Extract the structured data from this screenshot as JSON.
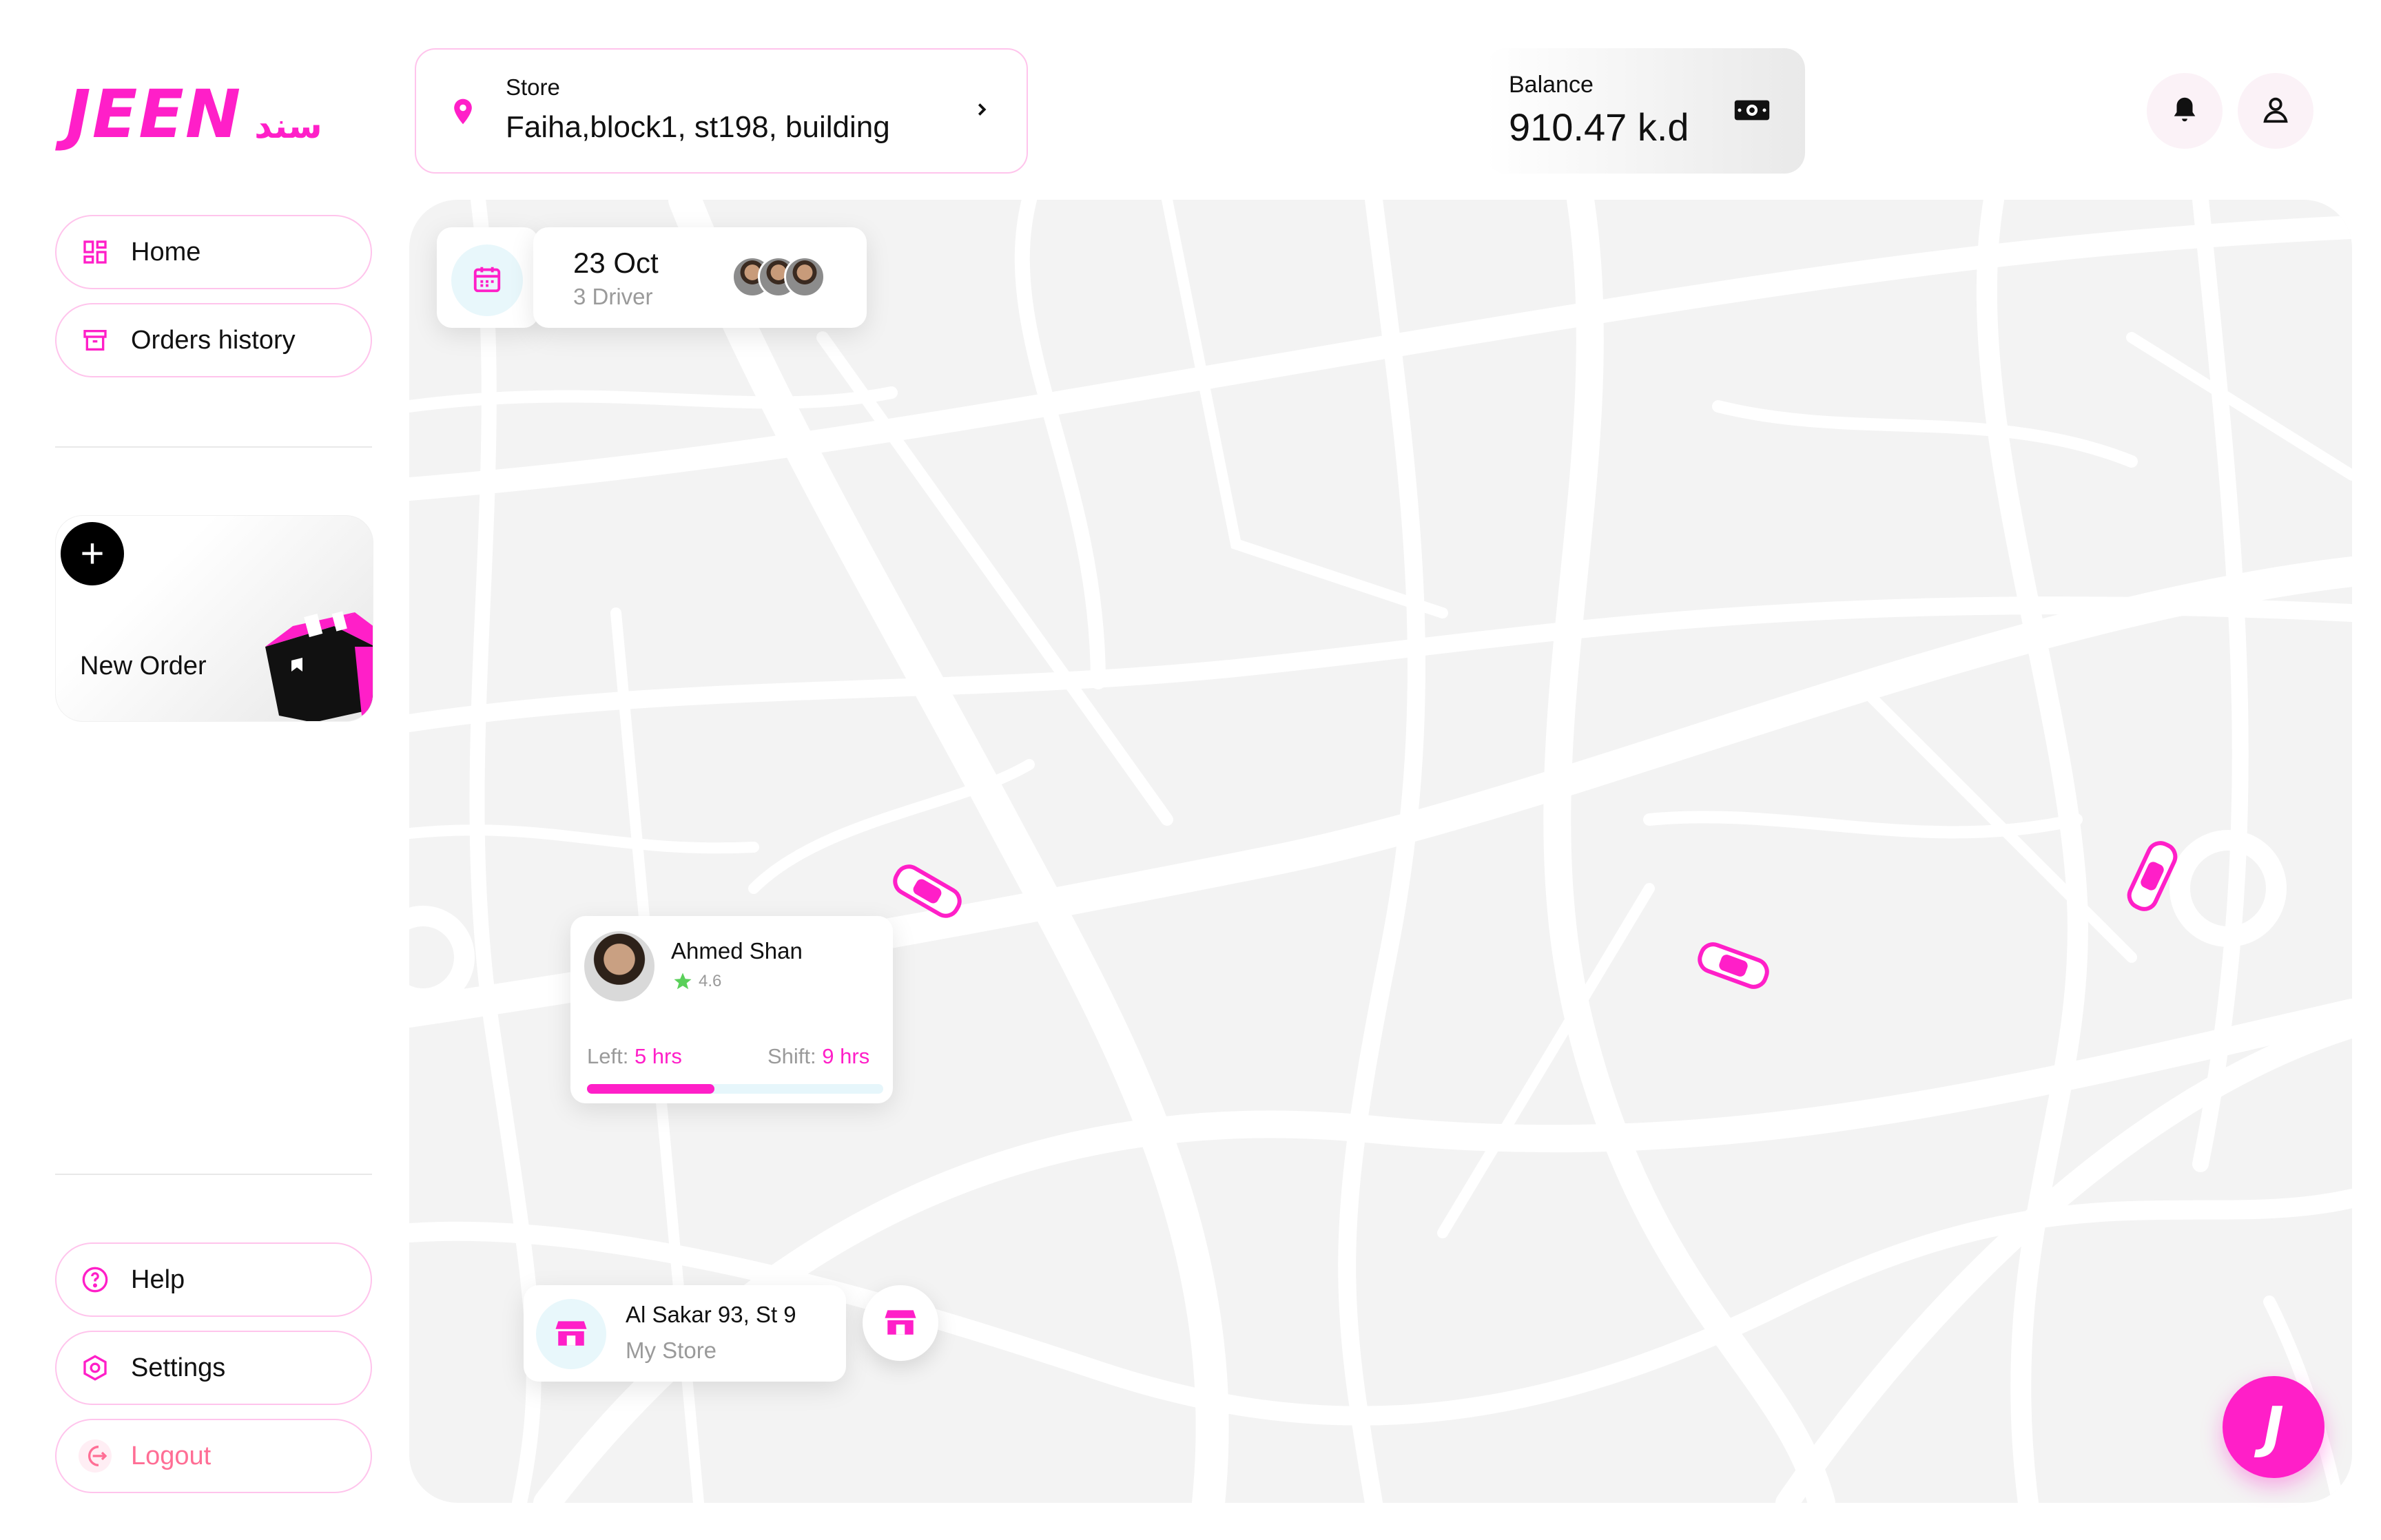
{
  "brand": {
    "logo_main": "JEEN",
    "logo_sub": "سند",
    "accent": "#ff1fc8"
  },
  "sidebar": {
    "items": [
      {
        "label": "Home",
        "icon": "dashboard-icon"
      },
      {
        "label": "Orders history",
        "icon": "archive-icon"
      }
    ],
    "new_order": {
      "label": "New Order",
      "icon": "plus-icon"
    },
    "bottom_items": [
      {
        "label": "Help",
        "icon": "help-icon"
      },
      {
        "label": "Settings",
        "icon": "settings-icon"
      },
      {
        "label": "Logout",
        "icon": "logout-icon"
      }
    ]
  },
  "header": {
    "store": {
      "caption": "Store",
      "address": "Faiha,block1, st198, building"
    },
    "balance": {
      "caption": "Balance",
      "value": "910.47 k.d"
    }
  },
  "map": {
    "date_card": {
      "date": "23 Oct",
      "drivers": "3 Driver"
    },
    "driver_card": {
      "name": "Ahmed Shan",
      "rating": "4.6",
      "left_label": "Left:",
      "left_value": "5 hrs",
      "shift_label": "Shift:",
      "shift_value": "9 hrs",
      "progress": 0.43
    },
    "location_card": {
      "title": "Al Sakar 93, St 9",
      "subtitle": "My Store"
    }
  },
  "fab": {
    "label": "J"
  }
}
